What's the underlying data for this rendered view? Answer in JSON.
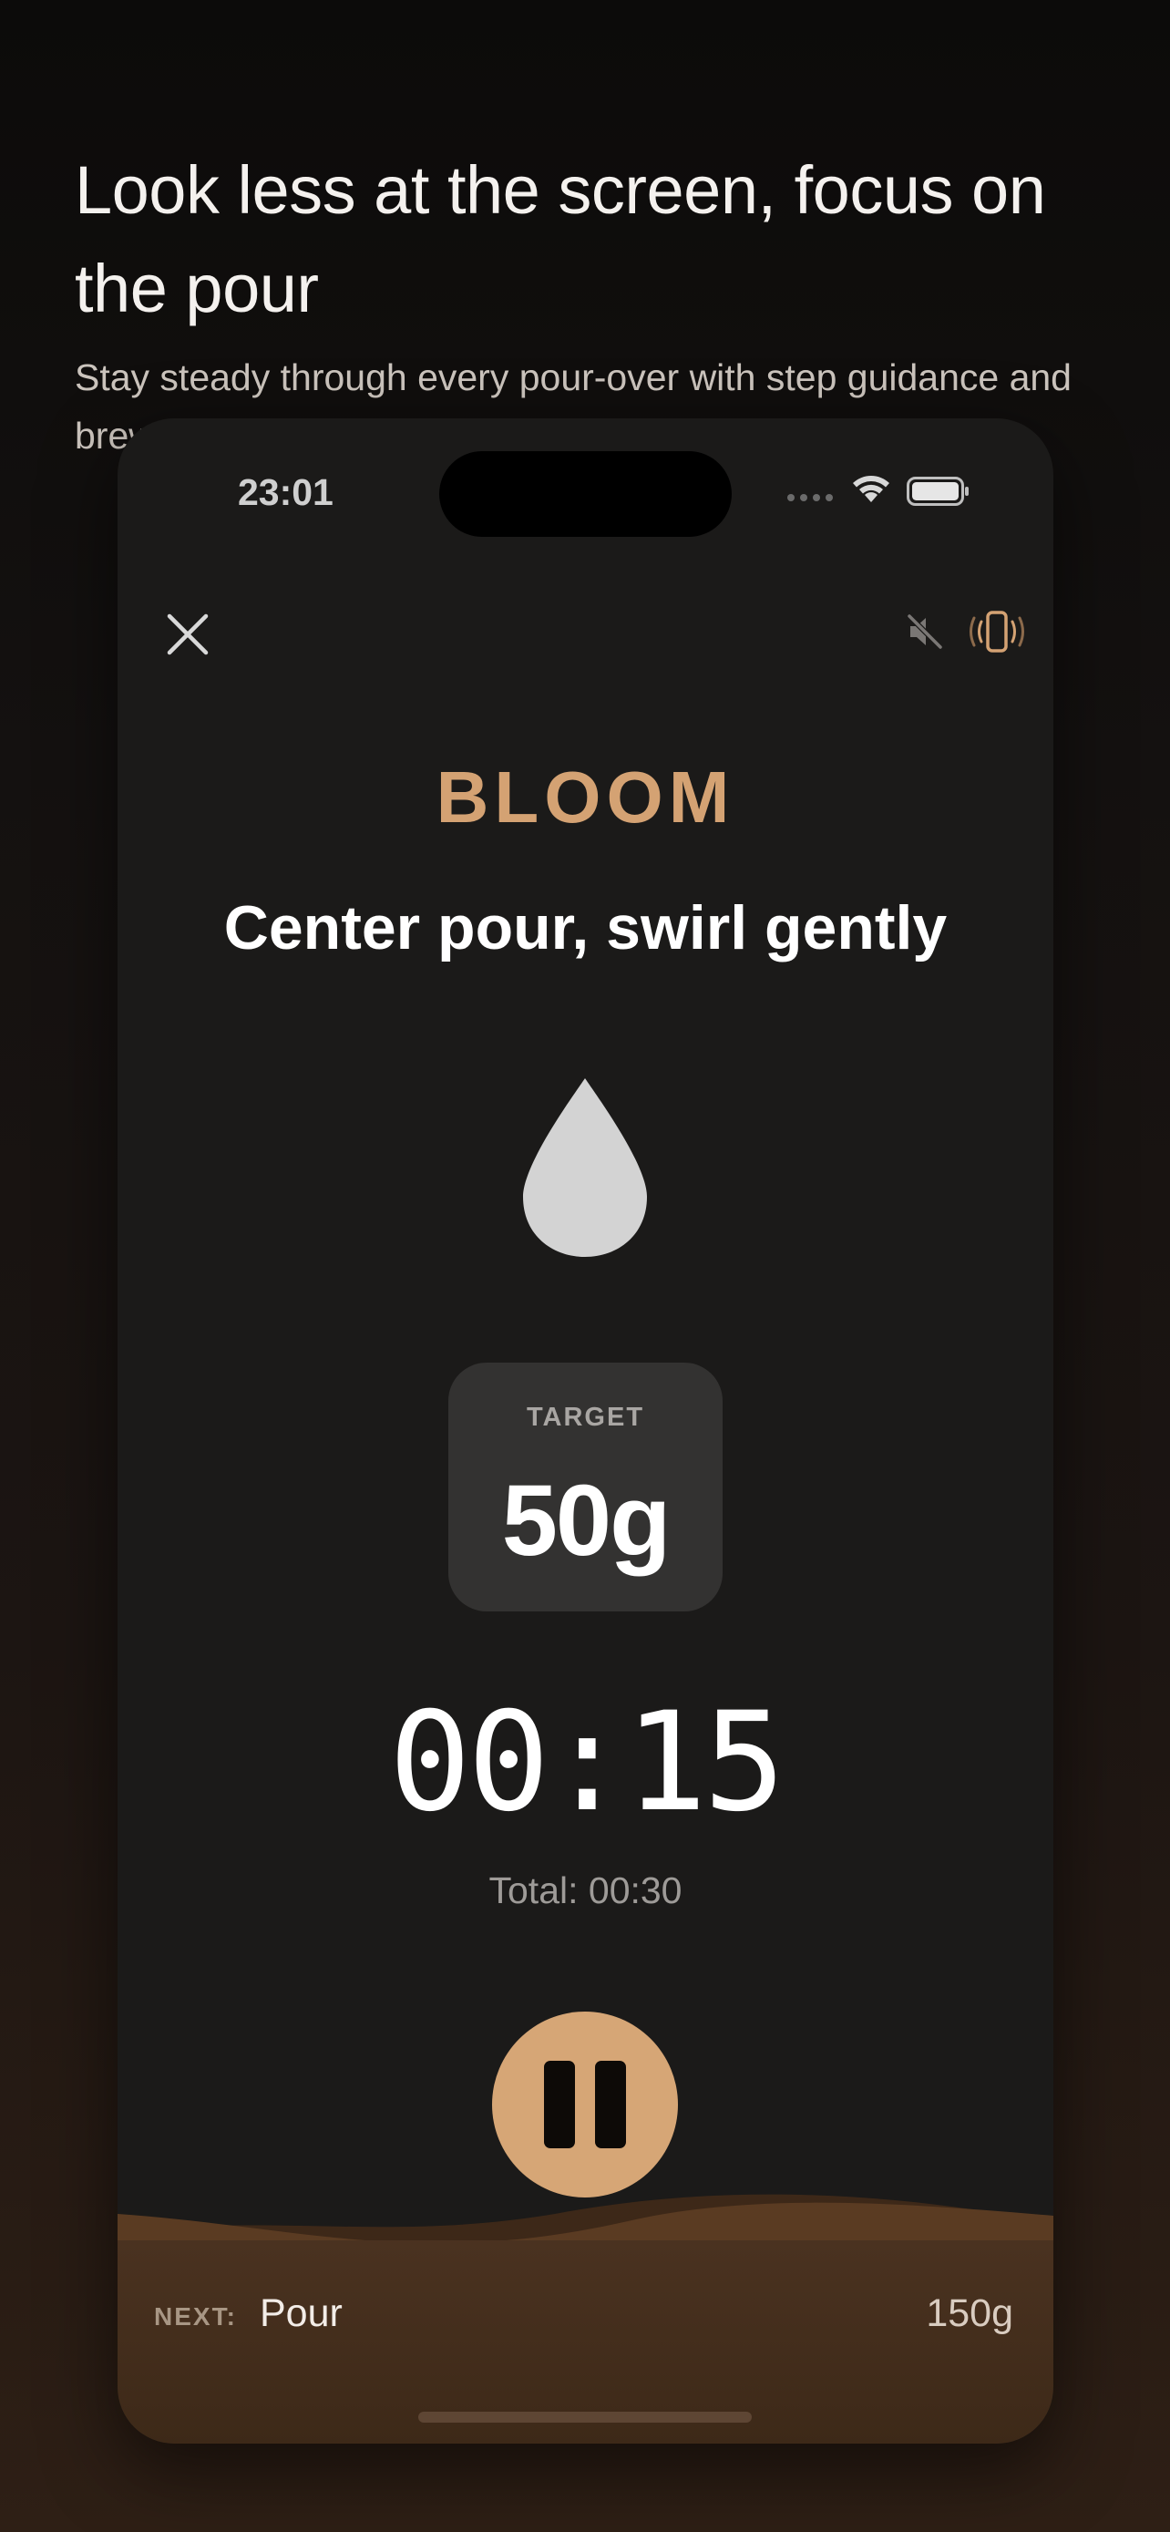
{
  "promo": {
    "headline": "Look less at the screen, focus on the pour",
    "subline": "Stay steady through every pour-over with step guidance and brew-assist features."
  },
  "status_bar": {
    "time": "23:01",
    "icons": [
      "cellular-dots-icon",
      "wifi-icon",
      "battery-icon"
    ]
  },
  "toolbar": {
    "close_icon": "close-icon",
    "mute_icon": "speaker-muted-icon",
    "vibrate_icon": "phone-vibrate-icon"
  },
  "step": {
    "title": "BLOOM",
    "instruction": "Center pour, swirl gently",
    "icon": "water-drop-icon"
  },
  "target": {
    "label": "TARGET",
    "value": "50g"
  },
  "timer": {
    "elapsed": "00:15",
    "total": "Total: 00:30"
  },
  "controls": {
    "pause_icon": "pause-icon"
  },
  "next": {
    "label": "NEXT:",
    "step": "Pour",
    "amount": "150g"
  },
  "colors": {
    "accent": "#d4a273",
    "pause_button": "#d6a676",
    "background": "#1b1a19",
    "card": "#333231",
    "coffee": "#5a3b22"
  }
}
